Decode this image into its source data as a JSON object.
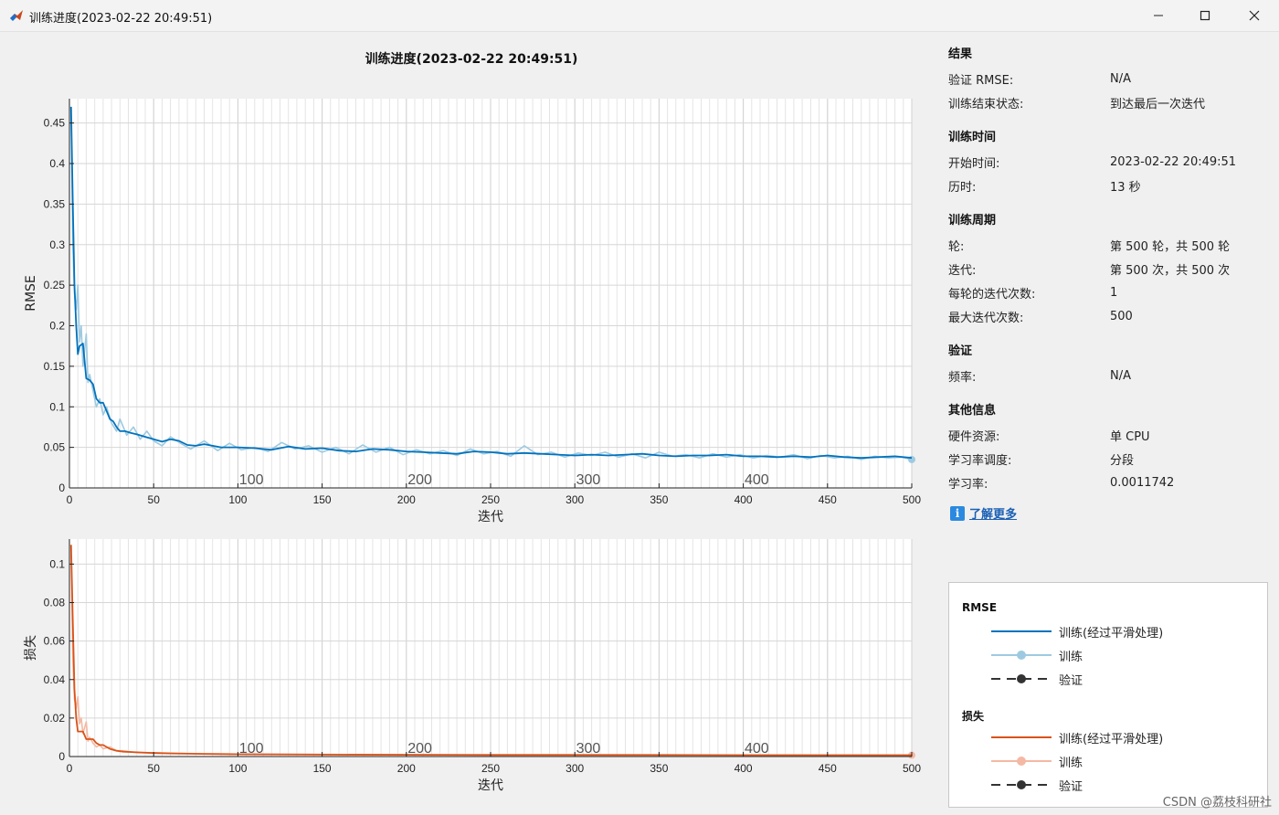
{
  "window": {
    "title": "训练进度(2023-02-22 20:49:51)"
  },
  "plot": {
    "title": "训练进度(2023-02-22 20:49:51)"
  },
  "chart_data": [
    {
      "type": "line",
      "name": "rmse",
      "ylabel": "RMSE",
      "xlabel": "迭代",
      "xlim": [
        0,
        500
      ],
      "ylim": [
        0,
        0.48
      ],
      "xticks": [
        0,
        50,
        100,
        150,
        200,
        250,
        300,
        350,
        400,
        450,
        500
      ],
      "yticks": [
        0,
        0.05,
        0.1,
        0.15,
        0.2,
        0.25,
        0.3,
        0.35,
        0.4,
        0.45
      ],
      "ytick_labels": [
        "0",
        "0.05",
        "0.1",
        "0.15",
        "0.2",
        "0.25",
        "0.3",
        "0.35",
        "0.4",
        "0.45"
      ],
      "epoch_labels": [
        {
          "x": 108,
          "text": "100"
        },
        {
          "x": 208,
          "text": "200"
        },
        {
          "x": 308,
          "text": "300"
        },
        {
          "x": 408,
          "text": "400"
        }
      ],
      "grid": true,
      "series": [
        {
          "name": "训练(经过平滑处理)",
          "color": "#0072bd",
          "x": [
            1,
            2,
            3,
            4,
            5,
            6,
            8,
            10,
            12,
            14,
            16,
            18,
            20,
            22,
            24,
            26,
            28,
            30,
            33,
            36,
            40,
            45,
            50,
            55,
            60,
            65,
            70,
            75,
            80,
            90,
            100,
            110,
            120,
            130,
            140,
            150,
            160,
            170,
            180,
            190,
            200,
            210,
            220,
            230,
            240,
            250,
            260,
            270,
            280,
            290,
            300,
            310,
            320,
            330,
            340,
            350,
            360,
            370,
            380,
            390,
            400,
            410,
            420,
            430,
            440,
            450,
            460,
            470,
            480,
            490,
            500
          ],
          "y": [
            0.47,
            0.35,
            0.25,
            0.2,
            0.165,
            0.175,
            0.178,
            0.135,
            0.133,
            0.128,
            0.11,
            0.105,
            0.105,
            0.095,
            0.085,
            0.082,
            0.075,
            0.07,
            0.07,
            0.068,
            0.066,
            0.063,
            0.06,
            0.057,
            0.06,
            0.058,
            0.053,
            0.052,
            0.054,
            0.05,
            0.05,
            0.049,
            0.047,
            0.051,
            0.048,
            0.049,
            0.046,
            0.045,
            0.048,
            0.047,
            0.045,
            0.044,
            0.043,
            0.042,
            0.045,
            0.044,
            0.042,
            0.043,
            0.042,
            0.041,
            0.04,
            0.041,
            0.04,
            0.041,
            0.042,
            0.04,
            0.039,
            0.04,
            0.04,
            0.041,
            0.039,
            0.039,
            0.038,
            0.039,
            0.038,
            0.04,
            0.038,
            0.037,
            0.038,
            0.039,
            0.037
          ]
        },
        {
          "name": "训练",
          "color": "#9ecae1",
          "x": [
            1,
            2,
            3,
            4,
            5,
            6,
            7,
            8,
            10,
            11,
            12,
            14,
            16,
            18,
            20,
            22,
            25,
            28,
            30,
            34,
            38,
            42,
            46,
            50,
            55,
            60,
            66,
            72,
            80,
            88,
            95,
            102,
            110,
            118,
            126,
            134,
            142,
            150,
            158,
            166,
            174,
            182,
            190,
            198,
            206,
            214,
            222,
            230,
            238,
            246,
            254,
            262,
            270,
            278,
            286,
            294,
            302,
            310,
            318,
            326,
            334,
            342,
            350,
            358,
            366,
            374,
            382,
            390,
            398,
            406,
            414,
            422,
            430,
            438,
            446,
            454,
            462,
            470,
            478,
            486,
            494,
            500
          ],
          "y": [
            0.46,
            0.3,
            0.24,
            0.22,
            0.25,
            0.18,
            0.2,
            0.15,
            0.19,
            0.13,
            0.14,
            0.12,
            0.1,
            0.11,
            0.09,
            0.1,
            0.08,
            0.07,
            0.085,
            0.065,
            0.075,
            0.06,
            0.07,
            0.058,
            0.052,
            0.063,
            0.055,
            0.048,
            0.058,
            0.046,
            0.055,
            0.047,
            0.05,
            0.045,
            0.056,
            0.048,
            0.052,
            0.044,
            0.05,
            0.042,
            0.053,
            0.044,
            0.05,
            0.041,
            0.047,
            0.042,
            0.046,
            0.04,
            0.048,
            0.042,
            0.045,
            0.039,
            0.052,
            0.041,
            0.044,
            0.038,
            0.043,
            0.04,
            0.044,
            0.038,
            0.042,
            0.037,
            0.044,
            0.039,
            0.041,
            0.037,
            0.042,
            0.038,
            0.041,
            0.037,
            0.04,
            0.038,
            0.041,
            0.036,
            0.04,
            0.037,
            0.039,
            0.035,
            0.039,
            0.037,
            0.038,
            0.035
          ]
        }
      ]
    },
    {
      "type": "line",
      "name": "loss",
      "ylabel": "损失",
      "xlabel": "迭代",
      "xlim": [
        0,
        500
      ],
      "ylim": [
        0,
        0.113
      ],
      "xticks": [
        0,
        50,
        100,
        150,
        200,
        250,
        300,
        350,
        400,
        450,
        500
      ],
      "yticks": [
        0,
        0.02,
        0.04,
        0.06,
        0.08,
        0.1
      ],
      "ytick_labels": [
        "0",
        "0.02",
        "0.04",
        "0.06",
        "0.08",
        "0.1"
      ],
      "epoch_labels": [
        {
          "x": 108,
          "text": "100"
        },
        {
          "x": 208,
          "text": "200"
        },
        {
          "x": 308,
          "text": "300"
        },
        {
          "x": 408,
          "text": "400"
        }
      ],
      "grid": true,
      "series": [
        {
          "name": "训练(经过平滑处理)",
          "color": "#d95319",
          "x": [
            1,
            2,
            3,
            4,
            5,
            6,
            8,
            10,
            12,
            14,
            16,
            18,
            20,
            24,
            28,
            32,
            40,
            50,
            60,
            80,
            100,
            150,
            200,
            250,
            300,
            350,
            400,
            450,
            500
          ],
          "y": [
            0.11,
            0.07,
            0.035,
            0.02,
            0.013,
            0.013,
            0.013,
            0.009,
            0.009,
            0.009,
            0.007,
            0.006,
            0.006,
            0.004,
            0.003,
            0.0025,
            0.0022,
            0.0018,
            0.0016,
            0.0014,
            0.0012,
            0.001,
            0.0009,
            0.0008,
            0.0008,
            0.0008,
            0.0007,
            0.0007,
            0.0007
          ]
        },
        {
          "name": "训练",
          "color": "#f4b9a4",
          "x": [
            1,
            2,
            3,
            4,
            5,
            6,
            7,
            8,
            10,
            11,
            12,
            14,
            16,
            18,
            20,
            24,
            28,
            32,
            40,
            50,
            60,
            80,
            100,
            150,
            200,
            250,
            300,
            350,
            400,
            450,
            500
          ],
          "y": [
            0.105,
            0.05,
            0.03,
            0.025,
            0.031,
            0.017,
            0.02,
            0.012,
            0.018,
            0.008,
            0.01,
            0.007,
            0.005,
            0.006,
            0.004,
            0.005,
            0.003,
            0.003,
            0.002,
            0.002,
            0.0018,
            0.0014,
            0.0013,
            0.0011,
            0.001,
            0.0009,
            0.0009,
            0.0008,
            0.0008,
            0.0007,
            0.0007
          ]
        }
      ]
    }
  ],
  "panel": {
    "result": {
      "heading": "结果",
      "rows": [
        {
          "k": "验证 RMSE:",
          "v": "N/A"
        },
        {
          "k": "训练结束状态:",
          "v": "到达最后一次迭代"
        }
      ]
    },
    "time": {
      "heading": "训练时间",
      "rows": [
        {
          "k": "开始时间:",
          "v": "2023-02-22 20:49:51"
        },
        {
          "k": "历时:",
          "v": "13 秒"
        }
      ]
    },
    "cycle": {
      "heading": "训练周期",
      "rows": [
        {
          "k": "轮:",
          "v": "第 500 轮，共 500 轮"
        },
        {
          "k": "迭代:",
          "v": "第 500 次，共 500 次"
        },
        {
          "k": "每轮的迭代次数:",
          "v": "1"
        },
        {
          "k": "最大迭代次数:",
          "v": "500"
        }
      ]
    },
    "validation": {
      "heading": "验证",
      "rows": [
        {
          "k": "频率:",
          "v": "N/A"
        }
      ]
    },
    "other": {
      "heading": "其他信息",
      "rows": [
        {
          "k": "硬件资源:",
          "v": "单 CPU"
        },
        {
          "k": "学习率调度:",
          "v": "分段"
        },
        {
          "k": "学习率:",
          "v": "0.0011742"
        }
      ]
    },
    "learn_more": "了解更多",
    "info_glyph": "i"
  },
  "legend": {
    "rmse_heading": "RMSE",
    "loss_heading": "损失",
    "rmse_items": [
      "训练(经过平滑处理)",
      "训练",
      "验证"
    ],
    "loss_items": [
      "训练(经过平滑处理)",
      "训练",
      "验证"
    ],
    "colors": {
      "rmse_smooth": "#0072bd",
      "rmse_raw": "#9ecae1",
      "loss_smooth": "#d95319",
      "loss_raw": "#f4b9a4",
      "validation": "#333333"
    }
  },
  "watermark": "CSDN @荔枝科研社"
}
